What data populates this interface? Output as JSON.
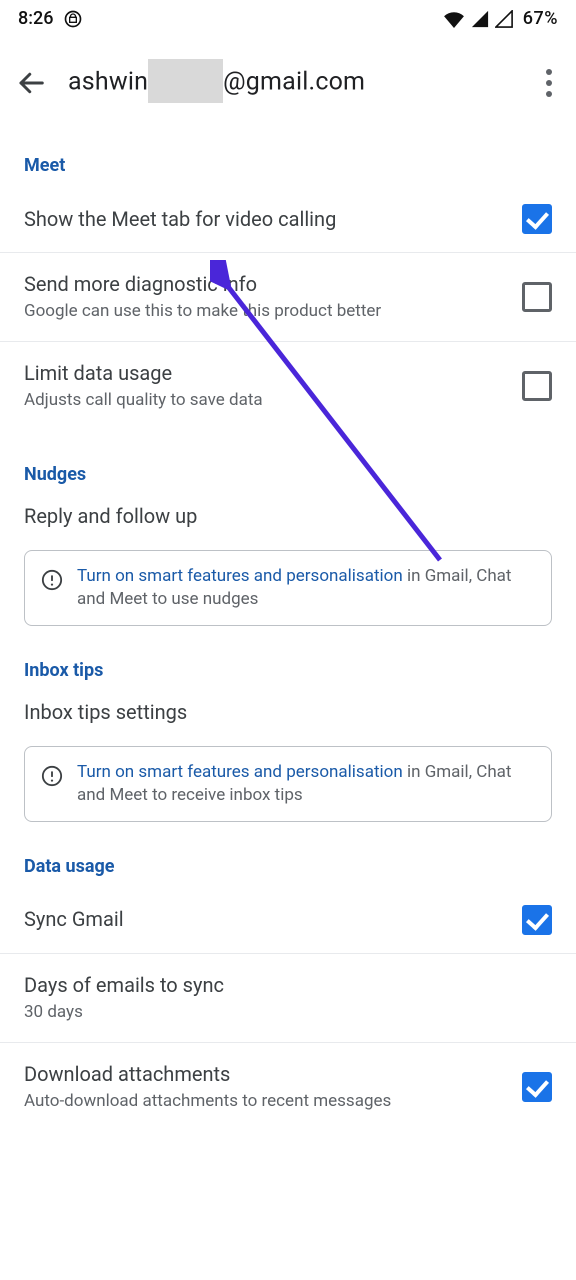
{
  "status_bar": {
    "time": "8:26",
    "battery": "67%"
  },
  "header": {
    "account_prefix": "ashwin",
    "account_suffix": "@gmail.com"
  },
  "sections": {
    "meet": {
      "title": "Meet",
      "show_meet_tab": {
        "label": "Show the Meet tab for video calling"
      },
      "diagnostic": {
        "label": "Send more diagnostic info",
        "sub": "Google can use this to make this product better"
      },
      "limit_data": {
        "label": "Limit data usage",
        "sub": "Adjusts call quality to save data"
      }
    },
    "nudges": {
      "title": "Nudges",
      "reply_follow": {
        "label": "Reply and follow up"
      },
      "notice_link": "Turn on smart features and personalisation",
      "notice_rest": " in Gmail, Chat and Meet to use nudges"
    },
    "inbox_tips": {
      "title": "Inbox tips",
      "settings": {
        "label": "Inbox tips settings"
      },
      "notice_link": "Turn on smart features and personalisation",
      "notice_rest": " in Gmail, Chat and Meet to receive inbox tips"
    },
    "data_usage": {
      "title": "Data usage",
      "sync_gmail": {
        "label": "Sync Gmail"
      },
      "days_sync": {
        "label": "Days of emails to sync",
        "sub": "30 days"
      },
      "download_att": {
        "label": "Download attachments",
        "sub": "Auto-download attachments to recent messages"
      }
    }
  }
}
